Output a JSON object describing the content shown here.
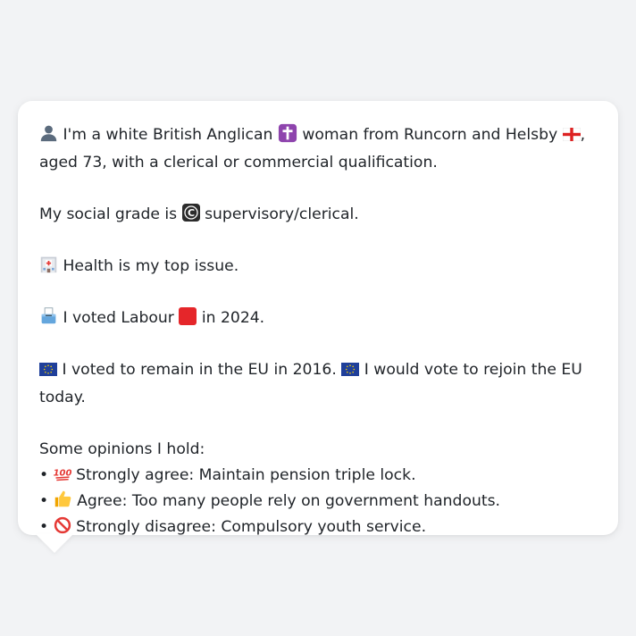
{
  "card": {
    "intro": {
      "icon": "bust-in-silhouette-icon",
      "text_before": "I'm a white British Anglican",
      "religion_icon": "latin-cross-icon",
      "text_mid": "woman from Runcorn and Helsby",
      "flag_icon": "england-flag-icon",
      "text_after": ", aged 73, with a clerical or commercial qualification."
    },
    "social": {
      "text_before": "My social grade is",
      "grade_icon": "circled-c-icon",
      "grade_letter": "C",
      "text_after": "supervisory/clerical."
    },
    "issue": {
      "icon": "hospital-icon",
      "text": "Health is my top issue."
    },
    "vote": {
      "icon": "ballot-box-icon",
      "text_before": "I voted Labour",
      "party_color": "#e5262a",
      "text_after": "in 2024."
    },
    "eu": {
      "icon": "eu-flag-icon",
      "text_1": "I voted to remain in the EU in 2016.",
      "text_2": "I would vote to rejoin the EU today."
    },
    "opinions": {
      "heading": "Some opinions I hold:",
      "bullet": "•",
      "items": [
        {
          "icon": "hundred-points-icon",
          "text": "Strongly agree: Maintain pension triple lock."
        },
        {
          "icon": "thumbs-up-icon",
          "text": "Agree: Too many people rely on government handouts."
        },
        {
          "icon": "no-entry-icon",
          "text": "Strongly disagree: Compulsory youth service."
        }
      ]
    }
  },
  "colors": {
    "background": "#f2f3f5",
    "card": "#ffffff",
    "text": "#1f2328",
    "labour_red": "#e5262a",
    "eu_blue": "#1f3f9a",
    "eu_star": "#f5d000"
  }
}
